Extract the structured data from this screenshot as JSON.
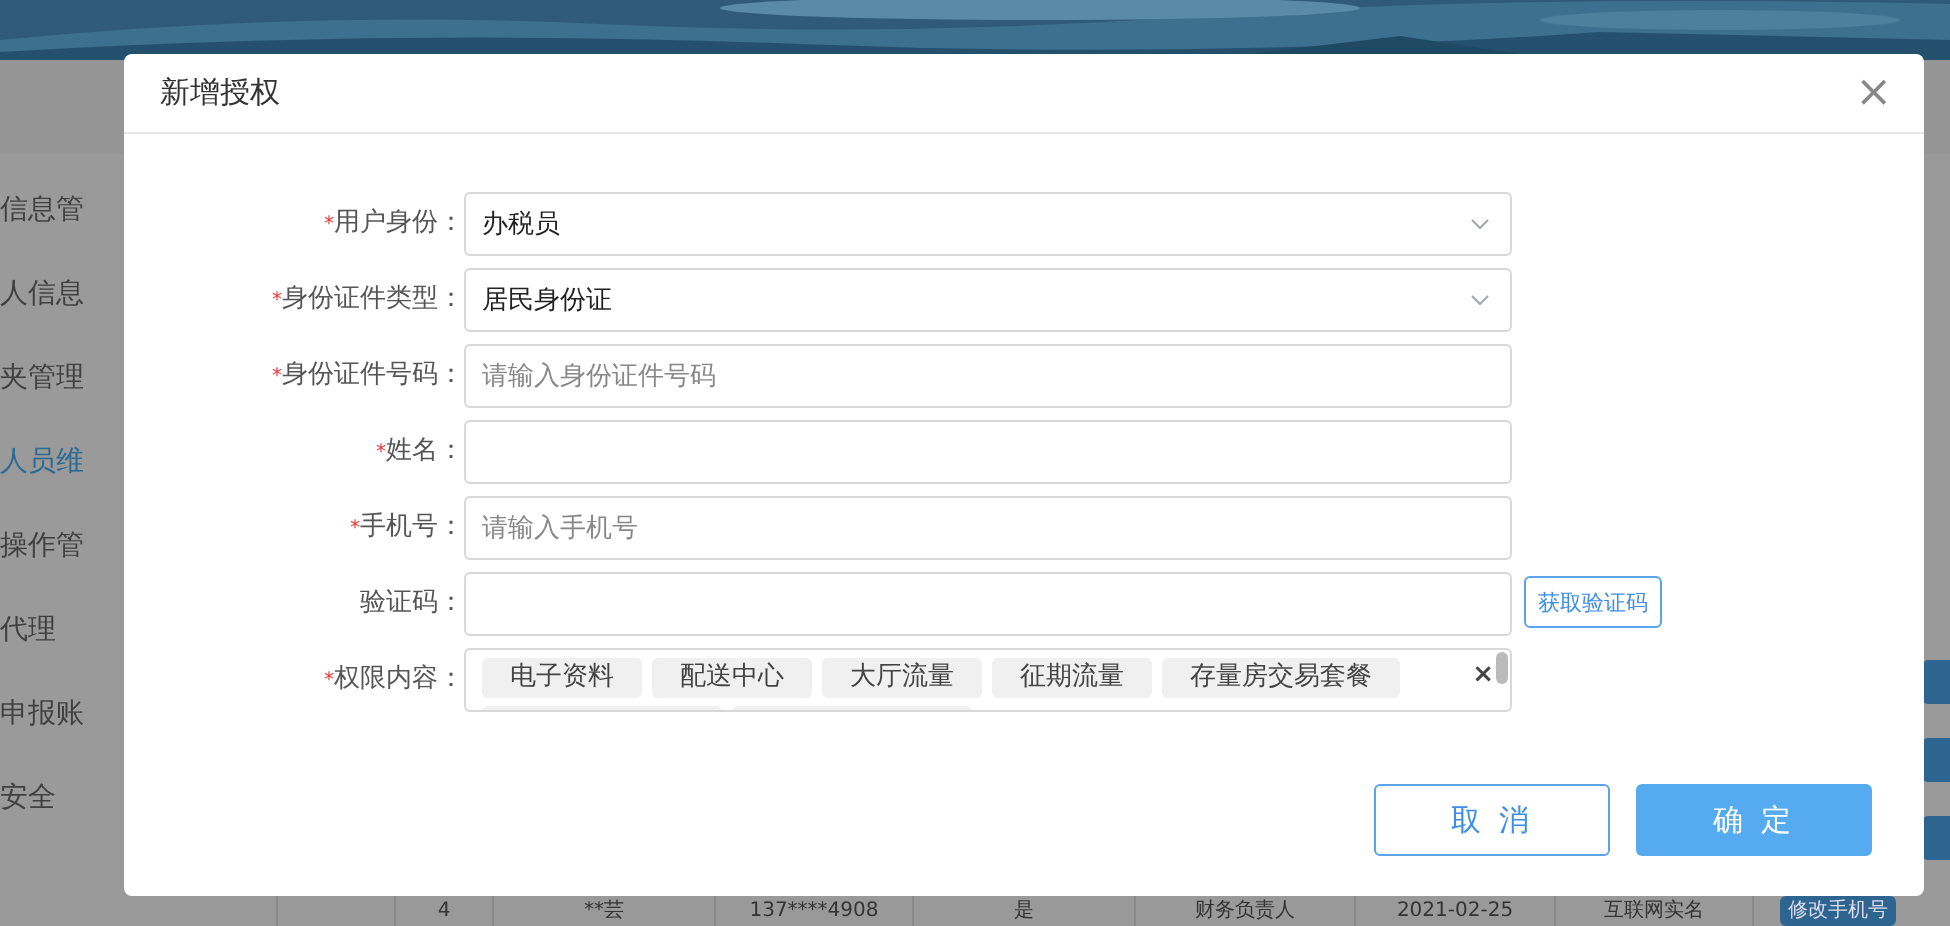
{
  "sidebar": {
    "items": [
      {
        "label": "信息管",
        "selected": false
      },
      {
        "label": "人信息",
        "selected": false
      },
      {
        "label": "夹管理",
        "selected": false
      },
      {
        "label": "人员维",
        "selected": true
      },
      {
        "label": "操作管",
        "selected": false
      },
      {
        "label": "代理",
        "selected": false
      },
      {
        "label": "申报账",
        "selected": false
      },
      {
        "label": "安全",
        "selected": false
      }
    ]
  },
  "table": {
    "rows": [
      {
        "cells": [
          "",
          "4",
          "**芸",
          "137****4908",
          "是",
          "财务负责人",
          "2021-02-25",
          "互联网实名"
        ],
        "action": "修改手机号"
      }
    ]
  },
  "dialog": {
    "title": "新增授权",
    "close": "×",
    "fields": [
      {
        "kind": "select",
        "required_mark": "*",
        "label": "用户身份：",
        "value": "办税员"
      },
      {
        "kind": "select",
        "required_mark": "*",
        "label": "身份证件类型：",
        "value": "居民身份证"
      },
      {
        "kind": "input",
        "required_mark": "*",
        "label": "身份证件号码：",
        "placeholder": "请输入身份证件号码"
      },
      {
        "kind": "input",
        "required_mark": "*",
        "label": "姓名："
      },
      {
        "kind": "input",
        "required_mark": "*",
        "label": "手机号：",
        "placeholder": "请输入手机号"
      },
      {
        "kind": "code",
        "label": "验证码：",
        "button": "获取验证码"
      },
      {
        "kind": "tags",
        "required_mark": "*",
        "label": "权限内容：",
        "tags": [
          "电子资料",
          "配送中心",
          "大厅流量",
          "征期流量",
          "存量房交易套餐"
        ],
        "clear": "×"
      }
    ],
    "buttons": [
      {
        "label": "取 消",
        "kind": "secondary"
      },
      {
        "label": "确 定",
        "kind": "primary"
      }
    ]
  }
}
